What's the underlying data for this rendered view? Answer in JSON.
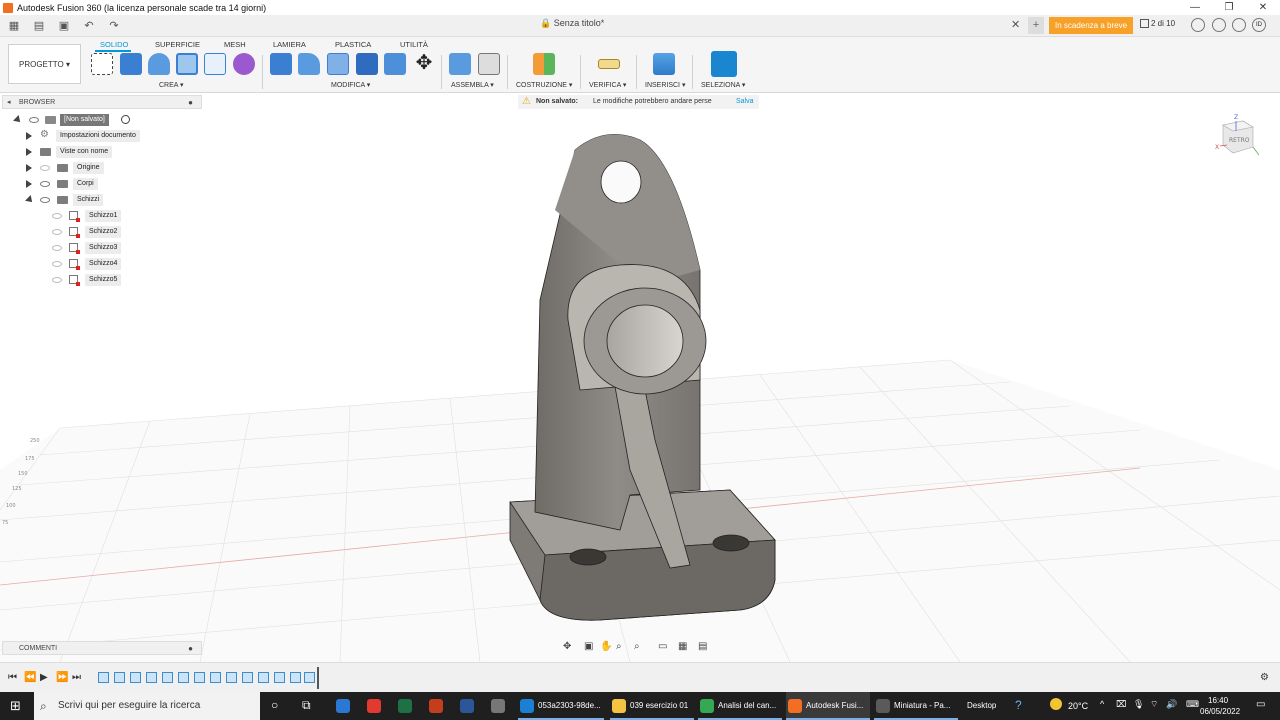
{
  "titlebar": {
    "title": "Autodesk Fusion 360 (la licenza personale scade tra 14 giorni)",
    "minimize": "—",
    "restore": "❐",
    "close": "✕"
  },
  "tabbar": {
    "doc_title": "🔒 Senza titolo*",
    "close": "✕",
    "add": "+",
    "expiry_badge": "In scadenza a breve",
    "jobs": "2 di 10",
    "user_initials": "ID"
  },
  "ribbon": {
    "project_button": "PROGETTO ▾",
    "tabs": [
      "SOLIDO",
      "SUPERFICIE",
      "MESH",
      "LAMIERA",
      "PLASTICA",
      "UTILITÀ"
    ],
    "groups": [
      "CREA ▾",
      "MODIFICA ▾",
      "ASSEMBLA ▾",
      "COSTRUZIONE ▾",
      "VERIFICA ▾",
      "INSERISCI ▾",
      "SELEZIONA ▾"
    ]
  },
  "browser": {
    "header": "BROWSER",
    "root": "[Non salvato]",
    "items": [
      {
        "label": "Impostazioni documento"
      },
      {
        "label": "Viste con nome"
      },
      {
        "label": "Origine"
      },
      {
        "label": "Corpi"
      },
      {
        "label": "Schizzi"
      }
    ],
    "sketches": [
      "Schizzo1",
      "Schizzo2",
      "Schizzo3",
      "Schizzo4",
      "Schizzo5"
    ]
  },
  "warning": {
    "label": "Non salvato:",
    "message": "Le modifiche potrebbero andare perse",
    "action": "Salva"
  },
  "viewcube": {
    "face": "RETRO",
    "axis_z": "Z",
    "axis_x": "X"
  },
  "comments": {
    "header": "COMMENTI"
  },
  "grid_labels": [
    "250",
    "175",
    "150",
    "125",
    "100",
    "75"
  ],
  "taskbar": {
    "search_placeholder": "Scrivi qui per eseguire la ricerca",
    "apps": [
      {
        "label": "053a2303-98de...",
        "color": "#1b7fd4"
      },
      {
        "label": "039 esercizio 01",
        "color": "#f5c342"
      },
      {
        "label": "Analisi del can...",
        "color": "#34a853"
      },
      {
        "label": "Autodesk Fusi...",
        "color": "#f26e22"
      },
      {
        "label": "Miniatura - Pa...",
        "color": "#5a5a5a"
      }
    ],
    "desktop": "Desktop",
    "weather": "20°C",
    "time": "16:40",
    "date": "06/05/2022"
  },
  "colors": {
    "accent": "#0696d7",
    "expiry": "#f7a128",
    "model_body": "#8a8680"
  }
}
